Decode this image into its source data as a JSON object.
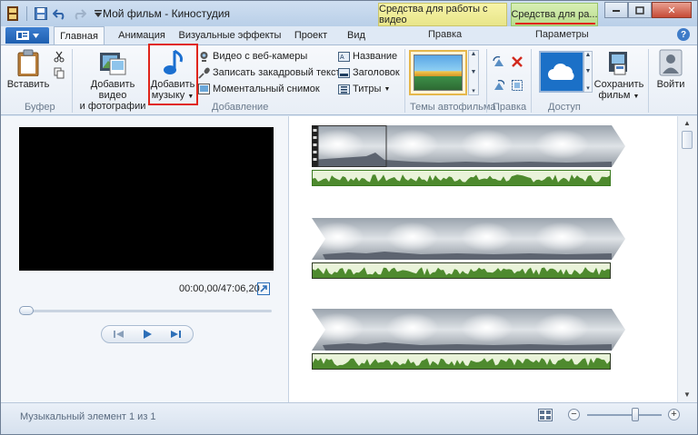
{
  "window": {
    "title": "Мой фильм - Киностудия",
    "context_tabs": {
      "video_tools": "Средства для работы с видео",
      "music_tools": "Средства для ра..."
    },
    "context_groups": {
      "edit": "Правка",
      "options": "Параметры"
    }
  },
  "tabs": [
    "Главная",
    "Анимация",
    "Визуальные эффекты",
    "Проект",
    "Вид"
  ],
  "ribbon": {
    "clipboard": {
      "paste": "Вставить",
      "group": "Буфер"
    },
    "add": {
      "add_video": [
        "Добавить видео",
        "и фотографии"
      ],
      "add_music": [
        "Добавить",
        "музыку"
      ],
      "webcam": "Видео с веб-камеры",
      "narration": "Записать закадровый текст",
      "snapshot": "Моментальный снимок",
      "title": "Название",
      "caption": "Заголовок",
      "credits": "Титры",
      "group": "Добавление"
    },
    "themes": {
      "group": "Темы автофильма"
    },
    "edit": {
      "group": "Правка"
    },
    "share": {
      "save_movie": [
        "Сохранить",
        "фильм"
      ],
      "group": "Доступ"
    },
    "signin": "Войти"
  },
  "player": {
    "timecode": "00:00,00/47:06,20",
    "position": 0.0
  },
  "status": {
    "text": "Музыкальный элемент 1 из 1",
    "zoom": 0.62
  },
  "colors": {
    "accent": "#1e5fb0",
    "highlight": "#e0251b",
    "audio_wave": "#4e8a2e"
  }
}
